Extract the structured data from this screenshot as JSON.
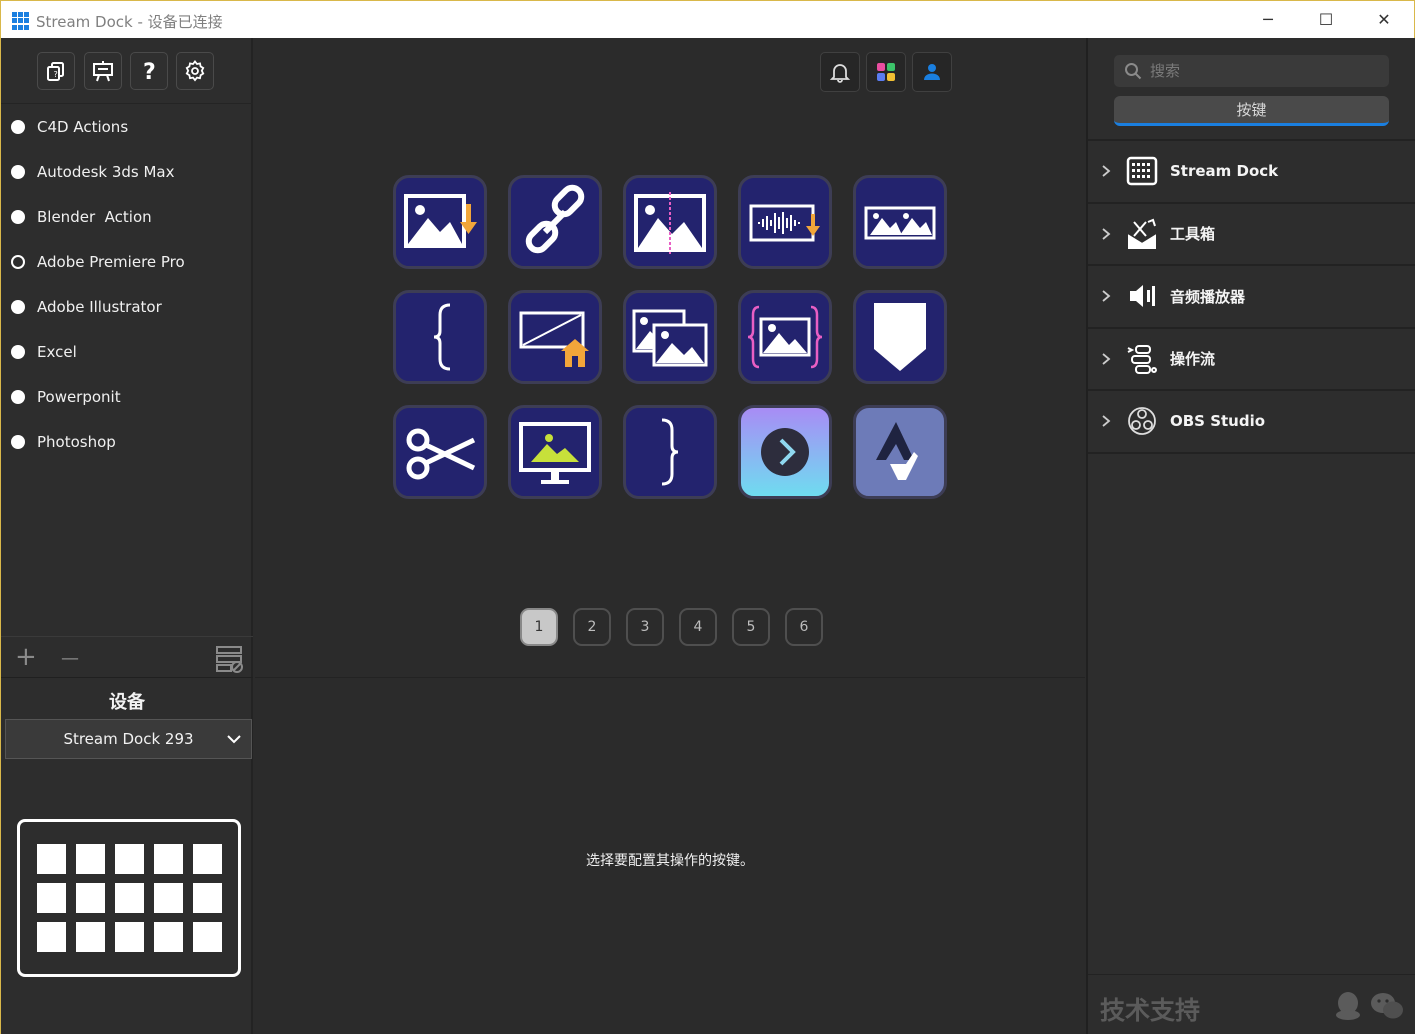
{
  "window": {
    "title": "Stream Dock - 设备已连接",
    "minimize": "─",
    "maximize": "☐",
    "close": "✕"
  },
  "left_panel": {
    "tools": [
      "copy-icon",
      "presentation-icon",
      "help-icon",
      "settings-icon"
    ],
    "profiles": [
      {
        "label": "C4D Actions",
        "active": false
      },
      {
        "label": "Autodesk 3ds Max",
        "active": false
      },
      {
        "label": "Blender  Action",
        "active": false
      },
      {
        "label": "Adobe Premiere Pro",
        "active": true
      },
      {
        "label": "Adobe Illustrator",
        "active": false
      },
      {
        "label": "Excel",
        "active": false
      },
      {
        "label": "Powerponit",
        "active": false
      },
      {
        "label": "Photoshop",
        "active": false
      }
    ],
    "add_label": "+",
    "remove_label": "—",
    "device_title": "设备",
    "device_selected": "Stream Dock 293"
  },
  "center": {
    "top_icons": [
      "bell-icon",
      "apps-store-icon",
      "user-icon"
    ],
    "keys": [
      "image-import-icon",
      "link-icon",
      "image-split-icon",
      "audio-import-icon",
      "image-strip-icon",
      "bracket-left-icon",
      "export-home-icon",
      "multi-image-icon",
      "image-trim-icon",
      "marker-icon",
      "scissors-icon",
      "monitor-image-icon",
      "bracket-right-icon",
      "next-arrow-icon",
      "logo-icon"
    ],
    "pages": [
      "1",
      "2",
      "3",
      "4",
      "5",
      "6"
    ],
    "active_page": "1",
    "config_hint": "选择要配置其操作的按键。"
  },
  "right_panel": {
    "search_placeholder": "搜索",
    "tab_label": "按键",
    "categories": [
      {
        "label": "Stream Dock",
        "icon": "grid-device-icon"
      },
      {
        "label": "工具箱",
        "icon": "toolbox-icon"
      },
      {
        "label": "音频播放器",
        "icon": "speaker-icon"
      },
      {
        "label": "操作流",
        "icon": "workflow-icon"
      },
      {
        "label": "OBS Studio",
        "icon": "obs-icon"
      }
    ],
    "support_label": "技术支持"
  },
  "colors": {
    "accent": "#1a7fe0",
    "key_bg": "#23236e",
    "panel_bg": "#2d2d2d"
  }
}
